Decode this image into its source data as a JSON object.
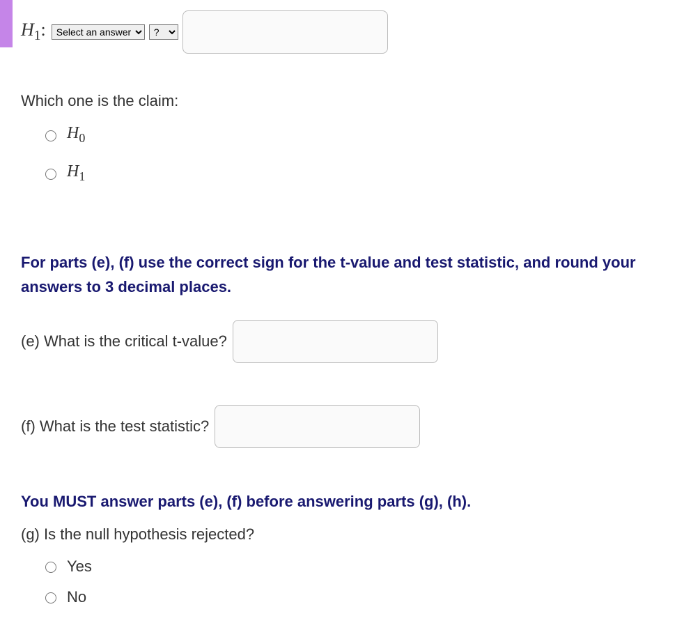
{
  "h1_row": {
    "label_prefix": "H",
    "label_sub": "1",
    "label_colon": ":",
    "select_answer_placeholder": "Select an answer",
    "select_q_placeholder": "?"
  },
  "claim": {
    "question": "Which one is the claim:",
    "options": [
      {
        "prefix": "H",
        "sub": "0"
      },
      {
        "prefix": "H",
        "sub": "1"
      }
    ]
  },
  "instruction_ef": "For parts (e), (f) use the correct sign for the t-value and test statistic, and round your answers to 3 decimal places.",
  "part_e": {
    "label": "(e) What is the critical t-value?"
  },
  "part_f": {
    "label": "(f) What is the test statistic?"
  },
  "instruction_gh": "You MUST answer parts (e), (f) before answering parts (g), (h).",
  "part_g": {
    "label": "(g) Is the null hypothesis rejected?",
    "options": [
      "Yes",
      "No"
    ]
  }
}
